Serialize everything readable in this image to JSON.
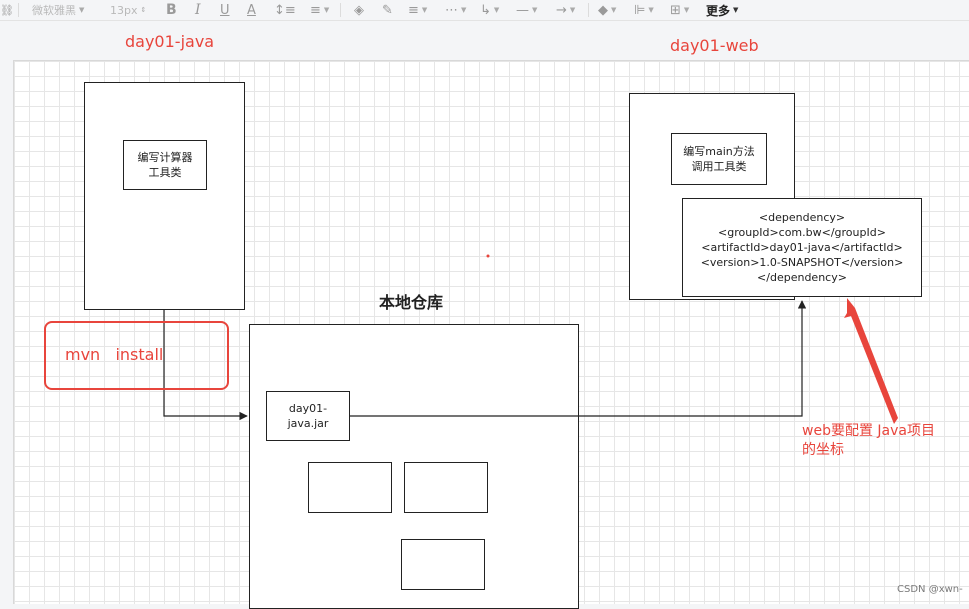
{
  "toolbar": {
    "font_family": "微软雅黑",
    "font_size": "13px",
    "bold": "B",
    "italic": "I",
    "underline": "U",
    "font_color": "A",
    "more": "更多"
  },
  "diagram": {
    "title_left": "day01-java",
    "title_right": "day01-web",
    "repo_title": "本地仓库",
    "calc_box": [
      "编写计算器",
      "工具类"
    ],
    "main_box": [
      "编写main方法",
      "调用工具类"
    ],
    "dependency_lines": [
      "<dependency>",
      "<groupId>com.bw</groupId>",
      "<artifactId>day01-java</artifactId>",
      "<version>1.0-SNAPSHOT</version>",
      "</dependency>"
    ],
    "jar_box": [
      "day01-",
      "java.jar"
    ],
    "mvn_label": "mvn   install",
    "note": [
      "web要配置 Java项目",
      "的坐标"
    ],
    "watermark": "CSDN @xwn-"
  },
  "colors": {
    "accent_red": "#e8453c",
    "line": "#222222"
  }
}
